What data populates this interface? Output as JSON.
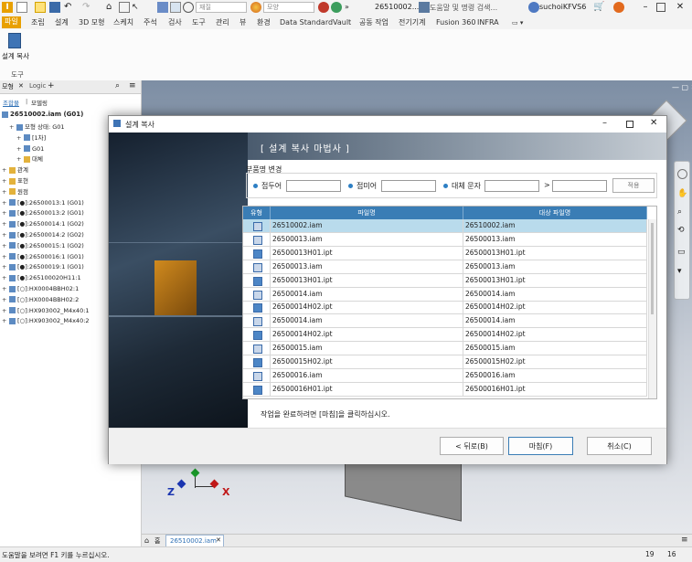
{
  "app": {
    "logo_letter": "I",
    "search_style_placeholder": "재질",
    "search_appearance_placeholder": "모양",
    "doc_title": "26510002...",
    "help_search_placeholder": "도움말 및 명령 검색...",
    "user": "suchoiKFVS6",
    "overflow": "»"
  },
  "ribbon_tabs": [
    "파일",
    "조립",
    "설계",
    "3D 모형",
    "스케치",
    "주석",
    "검사",
    "도구",
    "관리",
    "뷰",
    "환경",
    "Data Standard",
    "Vault",
    "공동 작업",
    "전기기계",
    "Fusion 360",
    "INFRA"
  ],
  "ribbon": {
    "command_label": "설계 복사",
    "panel_label": "도구"
  },
  "browser": {
    "tab_model": "모형",
    "tab_logic": "Logic",
    "tab_close": "✕",
    "tab_add": "+",
    "view_assembly": "조합물",
    "view_modeling": "모델링",
    "root": "26510002.iam (G01)",
    "items": [
      {
        "label": "모형 상태: G01",
        "indent": 1
      },
      {
        "label": "[1차]",
        "indent": 2
      },
      {
        "label": "G01",
        "indent": 2
      },
      {
        "label": "대체",
        "indent": 2
      },
      {
        "label": "관계",
        "indent": 0
      },
      {
        "label": "표현",
        "indent": 0
      },
      {
        "label": "원점",
        "indent": 0
      },
      {
        "label": "[●]:26500013:1 (G01)",
        "indent": 0
      },
      {
        "label": "[●]:26500013:2 (G01)",
        "indent": 0
      },
      {
        "label": "[●]:26500014:1 (G02)",
        "indent": 0
      },
      {
        "label": "[●]:26500014:2 (G02)",
        "indent": 0
      },
      {
        "label": "[●]:26500015:1 (G02)",
        "indent": 0
      },
      {
        "label": "[●]:26500016:1 (G01)",
        "indent": 0
      },
      {
        "label": "[●]:26500019:1 (G01)",
        "indent": 0
      },
      {
        "label": "[●]:265100020H11:1",
        "indent": 0
      },
      {
        "label": "[○]:HX0004BBH02:1",
        "indent": 0
      },
      {
        "label": "[○]:HX0004BBH02:2",
        "indent": 0
      },
      {
        "label": "[○]:HX903002_M4x40:1",
        "indent": 0
      },
      {
        "label": "[○]:HX903002_M4x40:2",
        "indent": 0
      }
    ]
  },
  "dialog": {
    "title": "설계 복사",
    "header": "[ 설계 복사 마법사 ]",
    "group_label": "부품명 변경",
    "prefix_label": "접두어",
    "suffix_label": "접미어",
    "replace_label": "대체 문자",
    "arrow": ">",
    "apply_button": "적용",
    "columns": [
      "유형",
      "파일명",
      "대상 파일명"
    ],
    "rows": [
      {
        "type": "iam",
        "file": "26510002.iam",
        "target": "26510002.iam",
        "selected": true
      },
      {
        "type": "iam",
        "file": "26500013.iam",
        "target": "26500013.iam"
      },
      {
        "type": "ipt",
        "file": "26500013H01.ipt",
        "target": "26500013H01.ipt"
      },
      {
        "type": "iam",
        "file": "26500013.iam",
        "target": "26500013.iam"
      },
      {
        "type": "ipt",
        "file": "26500013H01.ipt",
        "target": "26500013H01.ipt"
      },
      {
        "type": "iam",
        "file": "26500014.iam",
        "target": "26500014.iam"
      },
      {
        "type": "ipt",
        "file": "26500014H02.ipt",
        "target": "26500014H02.ipt"
      },
      {
        "type": "iam",
        "file": "26500014.iam",
        "target": "26500014.iam"
      },
      {
        "type": "ipt",
        "file": "26500014H02.ipt",
        "target": "26500014H02.ipt"
      },
      {
        "type": "iam",
        "file": "26500015.iam",
        "target": "26500015.iam"
      },
      {
        "type": "ipt",
        "file": "26500015H02.ipt",
        "target": "26500015H02.ipt"
      },
      {
        "type": "iam",
        "file": "26500016.iam",
        "target": "26500016.iam"
      },
      {
        "type": "ipt",
        "file": "26500016H01.ipt",
        "target": "26500016H01.ipt"
      }
    ],
    "instruction": "작업을 완료하려면 [마침]을 클릭하십시오.",
    "back_button": "< 뒤로(B)",
    "finish_button": "마침(F)",
    "cancel_button": "취소(C)"
  },
  "viewport": {
    "axis_x": "X",
    "axis_z": "Z"
  },
  "doc_tabs": {
    "home": "홈",
    "active_doc": "26510002.iam"
  },
  "status": {
    "message": "도움말을 보려면 F1 키를 누르십시오.",
    "count1": "19",
    "count2": "16"
  }
}
